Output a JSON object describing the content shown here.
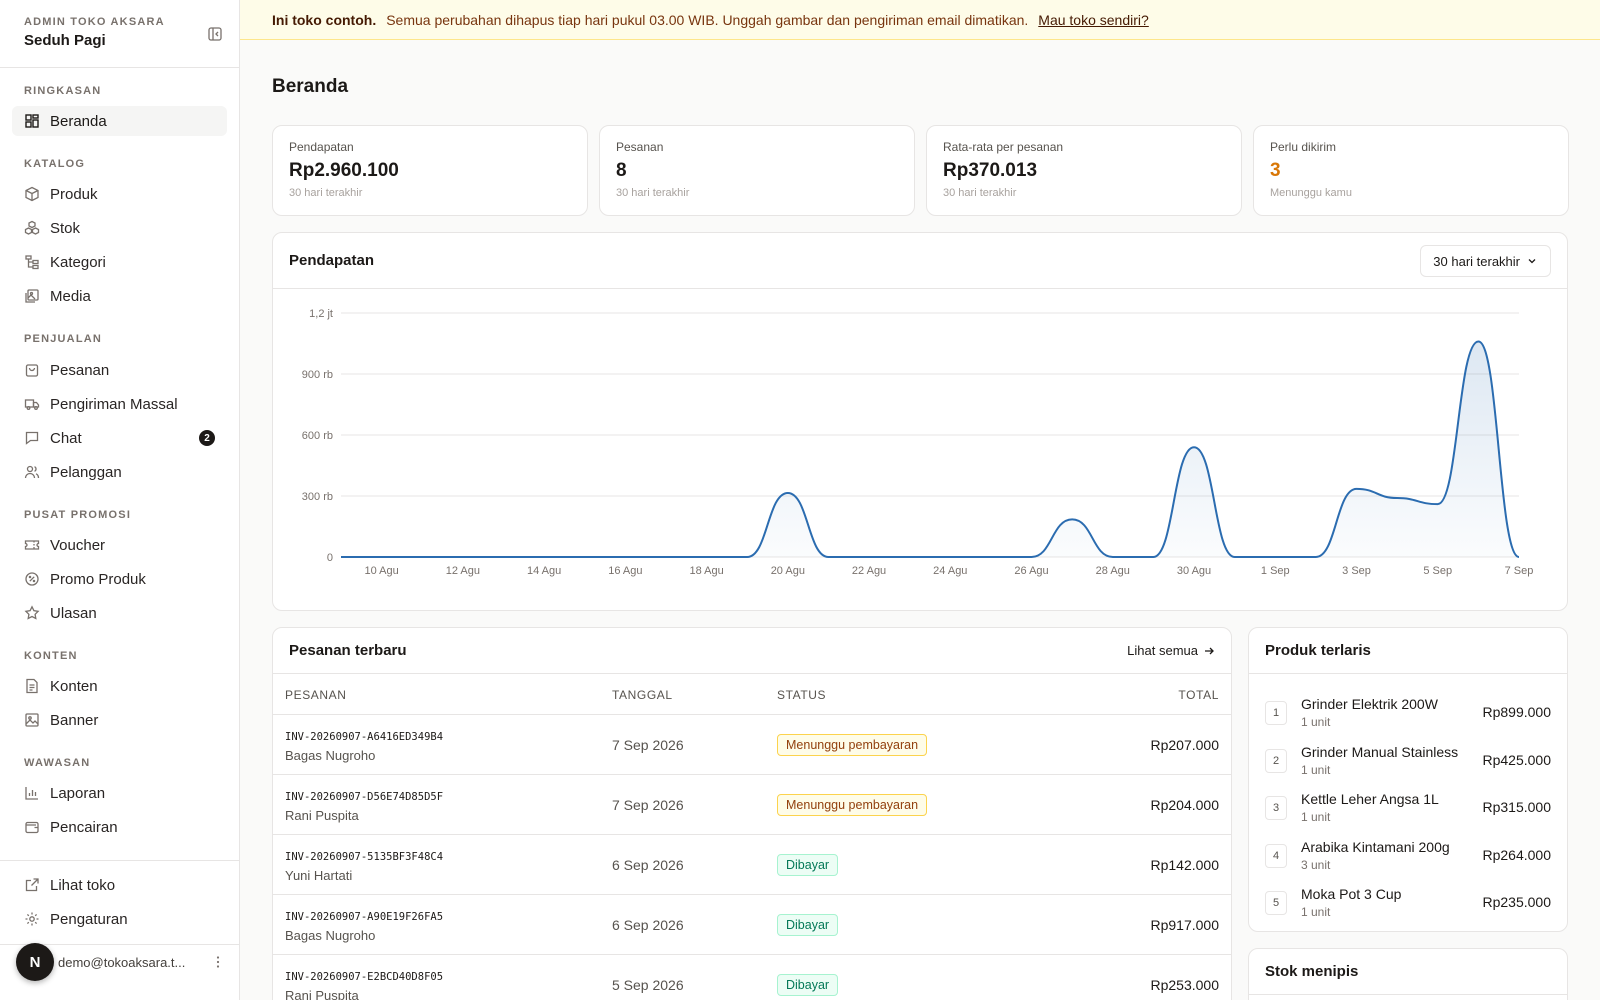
{
  "sidebar": {
    "store_label": "ADMIN TOKO AKSARA",
    "store_name": "Seduh Pagi",
    "groups": [
      {
        "label": "RINGKASAN",
        "items": [
          {
            "label": "Beranda",
            "icon": "dashboard-icon",
            "active": true
          }
        ]
      },
      {
        "label": "KATALOG",
        "items": [
          {
            "label": "Produk",
            "icon": "box-icon"
          },
          {
            "label": "Stok",
            "icon": "boxes-icon"
          },
          {
            "label": "Kategori",
            "icon": "tree-icon"
          },
          {
            "label": "Media",
            "icon": "images-icon"
          }
        ]
      },
      {
        "label": "PENJUALAN",
        "items": [
          {
            "label": "Pesanan",
            "icon": "shopping-bag-icon"
          },
          {
            "label": "Pengiriman Massal",
            "icon": "truck-icon"
          },
          {
            "label": "Chat",
            "icon": "chat-icon",
            "badge": "2"
          },
          {
            "label": "Pelanggan",
            "icon": "users-icon"
          }
        ]
      },
      {
        "label": "PUSAT PROMOSI",
        "items": [
          {
            "label": "Voucher",
            "icon": "ticket-icon"
          },
          {
            "label": "Promo Produk",
            "icon": "badge-percent-icon"
          },
          {
            "label": "Ulasan",
            "icon": "star-icon"
          }
        ]
      },
      {
        "label": "KONTEN",
        "items": [
          {
            "label": "Konten",
            "icon": "file-text-icon"
          },
          {
            "label": "Banner",
            "icon": "image-icon"
          }
        ]
      },
      {
        "label": "WAWASAN",
        "items": [
          {
            "label": "Laporan",
            "icon": "bar-chart-icon"
          },
          {
            "label": "Pencairan",
            "icon": "wallet-icon"
          }
        ]
      }
    ],
    "footer_items": [
      {
        "label": "Lihat toko",
        "icon": "external-link-icon"
      },
      {
        "label": "Pengaturan",
        "icon": "gear-icon"
      }
    ],
    "user": {
      "initial": "N",
      "email": "demo@tokoaksara.t..."
    }
  },
  "banner": {
    "strong": "Ini toko contoh.",
    "text": "Semua perubahan dihapus tiap hari pukul 03.00 WIB. Unggah gambar dan pengiriman email dimatikan.",
    "link": "Mau toko sendiri?"
  },
  "page_title": "Beranda",
  "stats": [
    {
      "label": "Pendapatan",
      "value": "Rp2.960.100",
      "sub": "30 hari terakhir"
    },
    {
      "label": "Pesanan",
      "value": "8",
      "sub": "30 hari terakhir"
    },
    {
      "label": "Rata-rata per pesanan",
      "value": "Rp370.013",
      "sub": "30 hari terakhir"
    },
    {
      "label": "Perlu dikirim",
      "value": "3",
      "sub": "Menunggu kamu",
      "accent": true
    }
  ],
  "revenue_card": {
    "title": "Pendapatan",
    "range_label": "30 hari terakhir"
  },
  "chart_data": {
    "type": "area",
    "y_ticks": [
      "0",
      "300 rb",
      "600 rb",
      "900 rb",
      "1,2 jt"
    ],
    "ylim": [
      0,
      1200000
    ],
    "x_ticks": [
      "10 Agu",
      "12 Agu",
      "14 Agu",
      "16 Agu",
      "18 Agu",
      "20 Agu",
      "22 Agu",
      "24 Agu",
      "26 Agu",
      "28 Agu",
      "30 Agu",
      "1 Sep",
      "3 Sep",
      "5 Sep",
      "7 Sep"
    ],
    "x": [
      "9 Agu",
      "10 Agu",
      "11 Agu",
      "12 Agu",
      "13 Agu",
      "14 Agu",
      "15 Agu",
      "16 Agu",
      "17 Agu",
      "18 Agu",
      "19 Agu",
      "20 Agu",
      "21 Agu",
      "22 Agu",
      "23 Agu",
      "24 Agu",
      "25 Agu",
      "26 Agu",
      "27 Agu",
      "28 Agu",
      "29 Agu",
      "30 Agu",
      "31 Agu",
      "1 Sep",
      "2 Sep",
      "3 Sep",
      "4 Sep",
      "5 Sep",
      "6 Sep",
      "7 Sep"
    ],
    "values": [
      0,
      0,
      0,
      0,
      0,
      0,
      0,
      0,
      0,
      0,
      0,
      315000,
      0,
      0,
      0,
      0,
      0,
      0,
      185000,
      0,
      0,
      540000,
      0,
      0,
      0,
      335000,
      290000,
      260000,
      1060000,
      0
    ],
    "grid": true
  },
  "orders": {
    "title": "Pesanan terbaru",
    "view_all": "Lihat semua",
    "columns": [
      "PESANAN",
      "TANGGAL",
      "STATUS",
      "TOTAL"
    ],
    "rows": [
      {
        "id": "INV-20260907-A6416ED349B4",
        "customer": "Bagas Nugroho",
        "date": "7 Sep 2026",
        "status": "Menunggu pembayaran",
        "status_kind": "wait",
        "total": "Rp207.000"
      },
      {
        "id": "INV-20260907-D56E74D85D5F",
        "customer": "Rani Puspita",
        "date": "7 Sep 2026",
        "status": "Menunggu pembayaran",
        "status_kind": "wait",
        "total": "Rp204.000"
      },
      {
        "id": "INV-20260907-5135BF3F48C4",
        "customer": "Yuni Hartati",
        "date": "6 Sep 2026",
        "status": "Dibayar",
        "status_kind": "paid",
        "total": "Rp142.000"
      },
      {
        "id": "INV-20260907-A90E19F26FA5",
        "customer": "Bagas Nugroho",
        "date": "6 Sep 2026",
        "status": "Dibayar",
        "status_kind": "paid",
        "total": "Rp917.000"
      },
      {
        "id": "INV-20260907-E2BCD40D8F05",
        "customer": "Rani Puspita",
        "date": "5 Sep 2026",
        "status": "Dibayar",
        "status_kind": "paid",
        "total": "Rp253.000"
      }
    ]
  },
  "best_sellers": {
    "title": "Produk terlaris",
    "items": [
      {
        "rank": "1",
        "name": "Grinder Elektrik 200W",
        "units": "1 unit",
        "price": "Rp899.000"
      },
      {
        "rank": "2",
        "name": "Grinder Manual Stainless",
        "units": "1 unit",
        "price": "Rp425.000"
      },
      {
        "rank": "3",
        "name": "Kettle Leher Angsa 1L",
        "units": "1 unit",
        "price": "Rp315.000"
      },
      {
        "rank": "4",
        "name": "Arabika Kintamani 200g",
        "units": "3 unit",
        "price": "Rp264.000"
      },
      {
        "rank": "5",
        "name": "Moka Pot 3 Cup",
        "units": "1 unit",
        "price": "Rp235.000"
      }
    ]
  },
  "low_stock": {
    "title": "Stok menipis"
  },
  "colors": {
    "accent": "#d97706",
    "line": "#2b6cb0",
    "wait": "#92400e",
    "paid": "#047857"
  }
}
